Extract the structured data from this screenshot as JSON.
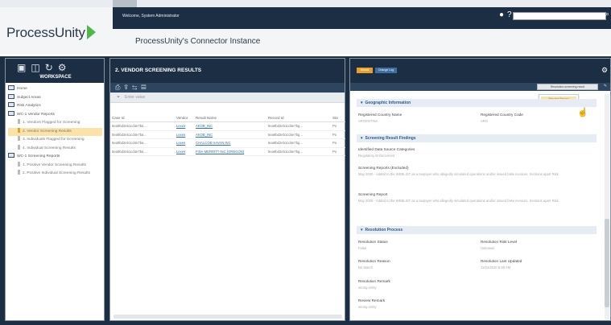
{
  "app": {
    "logo": "ProcessUnity"
  },
  "header": {
    "welcome": "Welcome, System Administrator",
    "instance": "ProcessUnity's Connector Instance"
  },
  "workspace": {
    "label": "WORKSPACE",
    "tree": [
      {
        "label": "Home",
        "level": 0
      },
      {
        "label": "Subject Areas",
        "level": 0
      },
      {
        "label": "Risk Analytics",
        "level": 0
      },
      {
        "label": "WC-1 Vendor Reports",
        "level": 0
      },
      {
        "label": "1. Vendors Flagged for Screening",
        "level": 1
      },
      {
        "label": "2. Vendor Screening Results",
        "level": 1,
        "selected": true
      },
      {
        "label": "3. Individuals Flagged for Screening",
        "level": 1
      },
      {
        "label": "4. Individual Screening Results",
        "level": 1
      },
      {
        "label": "WC-1 Screening Reports",
        "level": 0
      },
      {
        "label": "1. Positive Vendor Screening Results",
        "level": 1
      },
      {
        "label": "2. Positive Individual Screening Results",
        "level": 1
      }
    ]
  },
  "middle": {
    "title": "2. VENDOR SCREENING RESULTS",
    "filter_placeholder": "Enter value",
    "columns": [
      "Case Id",
      "Vendor",
      "Result Name",
      "Record Id",
      "Sta"
    ],
    "rows": [
      [
        "5ea9bd2eb1cd4e7ba...",
        "Lexes",
        "AKOB_INC",
        "5ea9bd2eb1cd4e7bg...",
        "Po"
      ],
      [
        "5ea9bd2eb1cd4e7ba...",
        "Lexes",
        "AKOB_INC",
        "5ea9bd2eb1cd4e7bg...",
        "Po"
      ],
      [
        "5ea9bd2eb1cd4e7ba...",
        "Lexes",
        "CHALCOB HAVAN INC",
        "5ea9bd2eb1cd4e7bg...",
        "Po"
      ],
      [
        "5ea9bd2eb1cd4e7ba...",
        "Lexes",
        "FISH MERRITT INC (OREGON)",
        "5ea9bd2eb1cd4e7bg...",
        "Po"
      ]
    ]
  },
  "right": {
    "badge_orange": "Details",
    "badge_blue": "Change Log",
    "tooltip": "Resolution screening result",
    "dropdown_option": "Resolve Record",
    "sections": {
      "geo": "Geographic Information",
      "findings": "Screening Result Findings",
      "resolution": "Resolution Process"
    },
    "fields": {
      "reg_country_name_label": "Registered Country Name",
      "reg_country_name_value": "ARGENTINA",
      "reg_country_code_label": "Registered Country Code",
      "reg_country_code_value": "ARG",
      "cat_label": "Identified Data Source Categories",
      "cat_value": "Regulatory Enforcement",
      "rep_excl_label": "Screening Reports (Excluded)",
      "rep_excl_value": "May 2020 - Added to the WEBLIST as a taxpayer who allegedly simulated operations and/or issued false invoices. Sections apart Risk.",
      "rep_label": "Screening Report",
      "rep_value": "May 2020 - Added to the WEBLIST as a taxpayer who allegedly simulated operations and/or issued false invoices. Sections apart Risk.",
      "res_status_label": "Resolution Status",
      "res_status_value": "False",
      "res_risk_label": "Resolution Risk Level",
      "res_risk_value": "Unknown",
      "res_reason_label": "Resolution Reason",
      "res_reason_value": "No Match",
      "res_updated_label": "Resolution Last Updated",
      "res_updated_value": "11/01/2020 6:38 AM",
      "res_remark_label": "Resolution Remark",
      "res_remark_value": "wrong entity",
      "rev_remark_label": "Review Remark",
      "rev_remark_value": "wrong entity"
    }
  }
}
